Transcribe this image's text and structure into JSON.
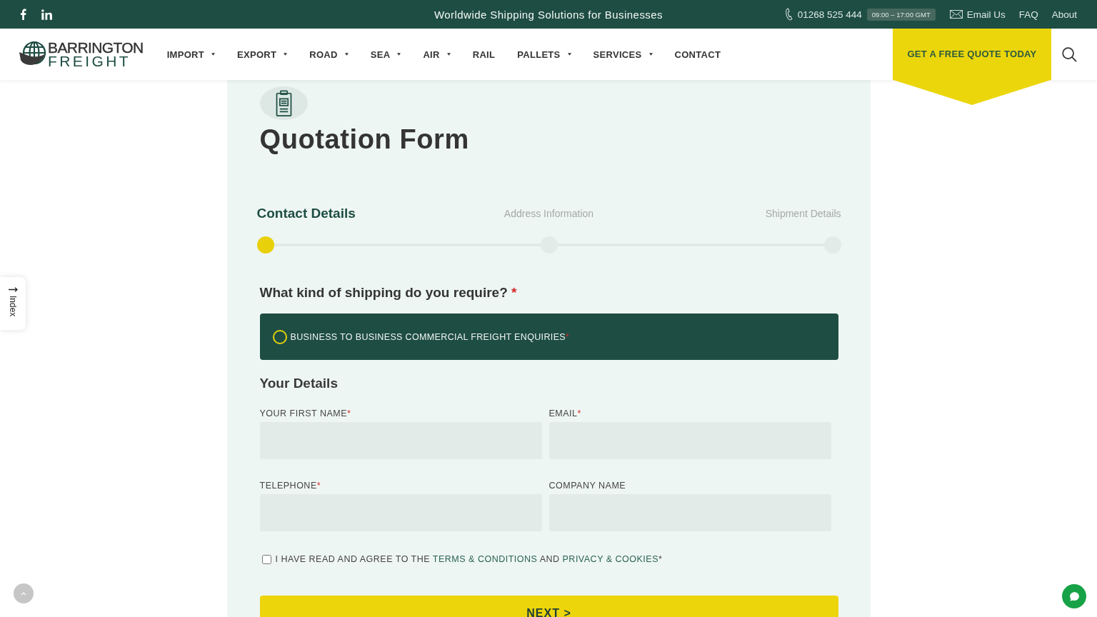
{
  "top_bar": {
    "tagline": "Worldwide Shipping Solutions for Businesses",
    "phone": {
      "number": "01268 525 444",
      "hours": "09:00 – 17:00 GMT"
    },
    "links": [
      {
        "label": "Email Us",
        "kind": "email"
      },
      {
        "label": "FAQ",
        "kind": "plain"
      },
      {
        "label": "About",
        "kind": "plain"
      }
    ]
  },
  "header": {
    "logo": {
      "line_1": "BARRINGTON",
      "line_2": "FREIGHT"
    },
    "nav": [
      {
        "label": "IMPORT",
        "dropdown": true
      },
      {
        "label": "EXPORT",
        "dropdown": true
      },
      {
        "label": "ROAD",
        "dropdown": true
      },
      {
        "label": "SEA",
        "dropdown": true
      },
      {
        "label": "AIR",
        "dropdown": true
      },
      {
        "label": "RAIL",
        "dropdown": false
      },
      {
        "label": "PALLETS",
        "dropdown": true
      },
      {
        "label": "SERVICES",
        "dropdown": true
      },
      {
        "label": "CONTACT",
        "dropdown": false
      }
    ],
    "cta": "GET A FREE QUOTE TODAY"
  },
  "side_tab": {
    "label": "Index"
  },
  "form": {
    "title": "Quotation Form",
    "steps": [
      {
        "label": "Contact Details",
        "selected": true
      },
      {
        "label": "Address Information",
        "selected": false
      },
      {
        "label": "Shipment Details",
        "selected": false
      }
    ],
    "question": {
      "label": "What kind of shipping do you require?",
      "required_mark": "*"
    },
    "options": [
      {
        "label": "BUSINESS TO BUSINESS COMMERCIAL FREIGHT ENQUIRIES",
        "required_mark": "*",
        "selected": false
      }
    ],
    "section": "Your Details",
    "fields": [
      {
        "label": "YOUR FIRST NAME",
        "required_mark": "*"
      },
      {
        "label": "EMAIL",
        "required_mark": "*"
      },
      {
        "label": "TELEPHONE",
        "required_mark": "*"
      },
      {
        "label": "COMPANY NAME"
      }
    ],
    "consent": {
      "checked": false,
      "parts": [
        {
          "kind": "text",
          "text": "I HAVE READ AND AGREE TO THE "
        },
        {
          "kind": "link",
          "text": "TERMS & CONDITIONS"
        },
        {
          "kind": "text",
          "text": " AND "
        },
        {
          "kind": "link",
          "text": "PRIVACY & COOKIES"
        },
        {
          "kind": "text",
          "text": "*"
        }
      ]
    },
    "next": "NEXT >"
  }
}
